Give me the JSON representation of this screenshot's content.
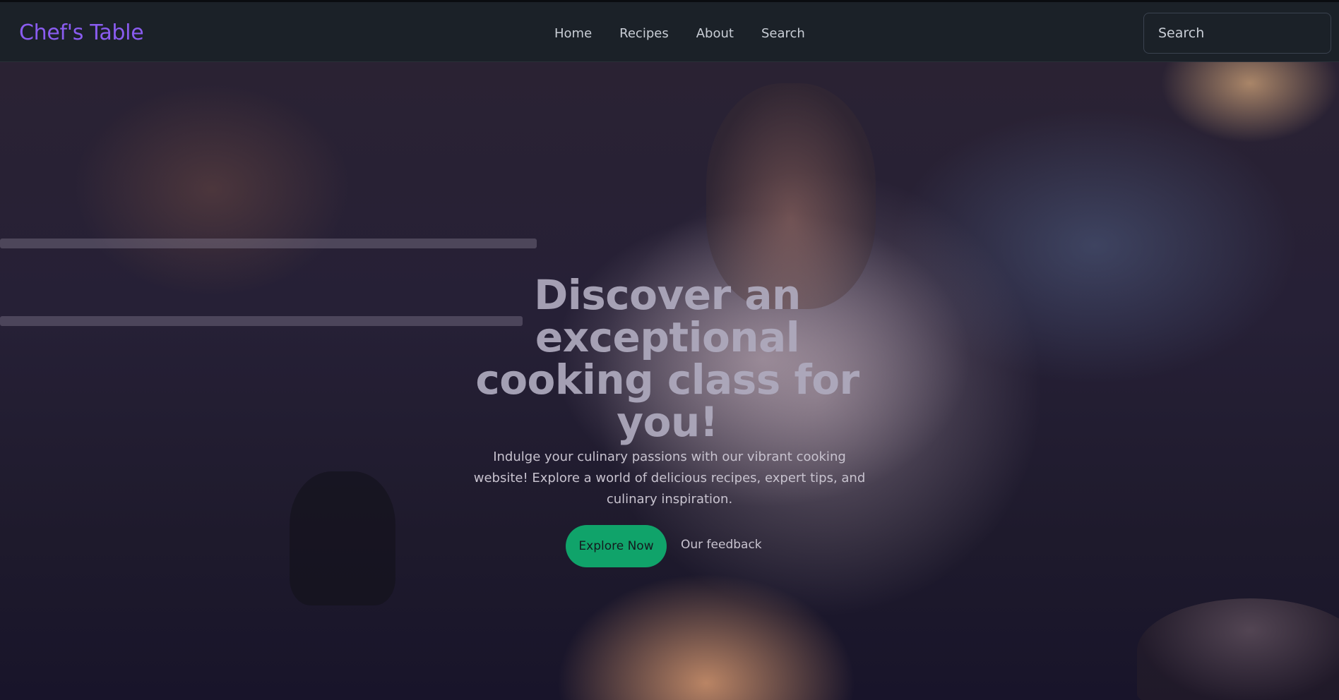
{
  "header": {
    "brand": "Chef's Table",
    "brand_color": "#8a5cf0",
    "nav": [
      {
        "label": "Home"
      },
      {
        "label": "Recipes"
      },
      {
        "label": "About"
      },
      {
        "label": "Search"
      }
    ],
    "search": {
      "placeholder": "Search",
      "value": ""
    }
  },
  "hero": {
    "title": "Discover an exceptional cooking class for you!",
    "description": "Indulge your culinary passions with our vibrant cooking website! Explore a world of delicious recipes, expert tips, and culinary inspiration.",
    "primary_button": "Explore Now",
    "primary_color": "#10a36a",
    "secondary_link": "Our feedback"
  }
}
